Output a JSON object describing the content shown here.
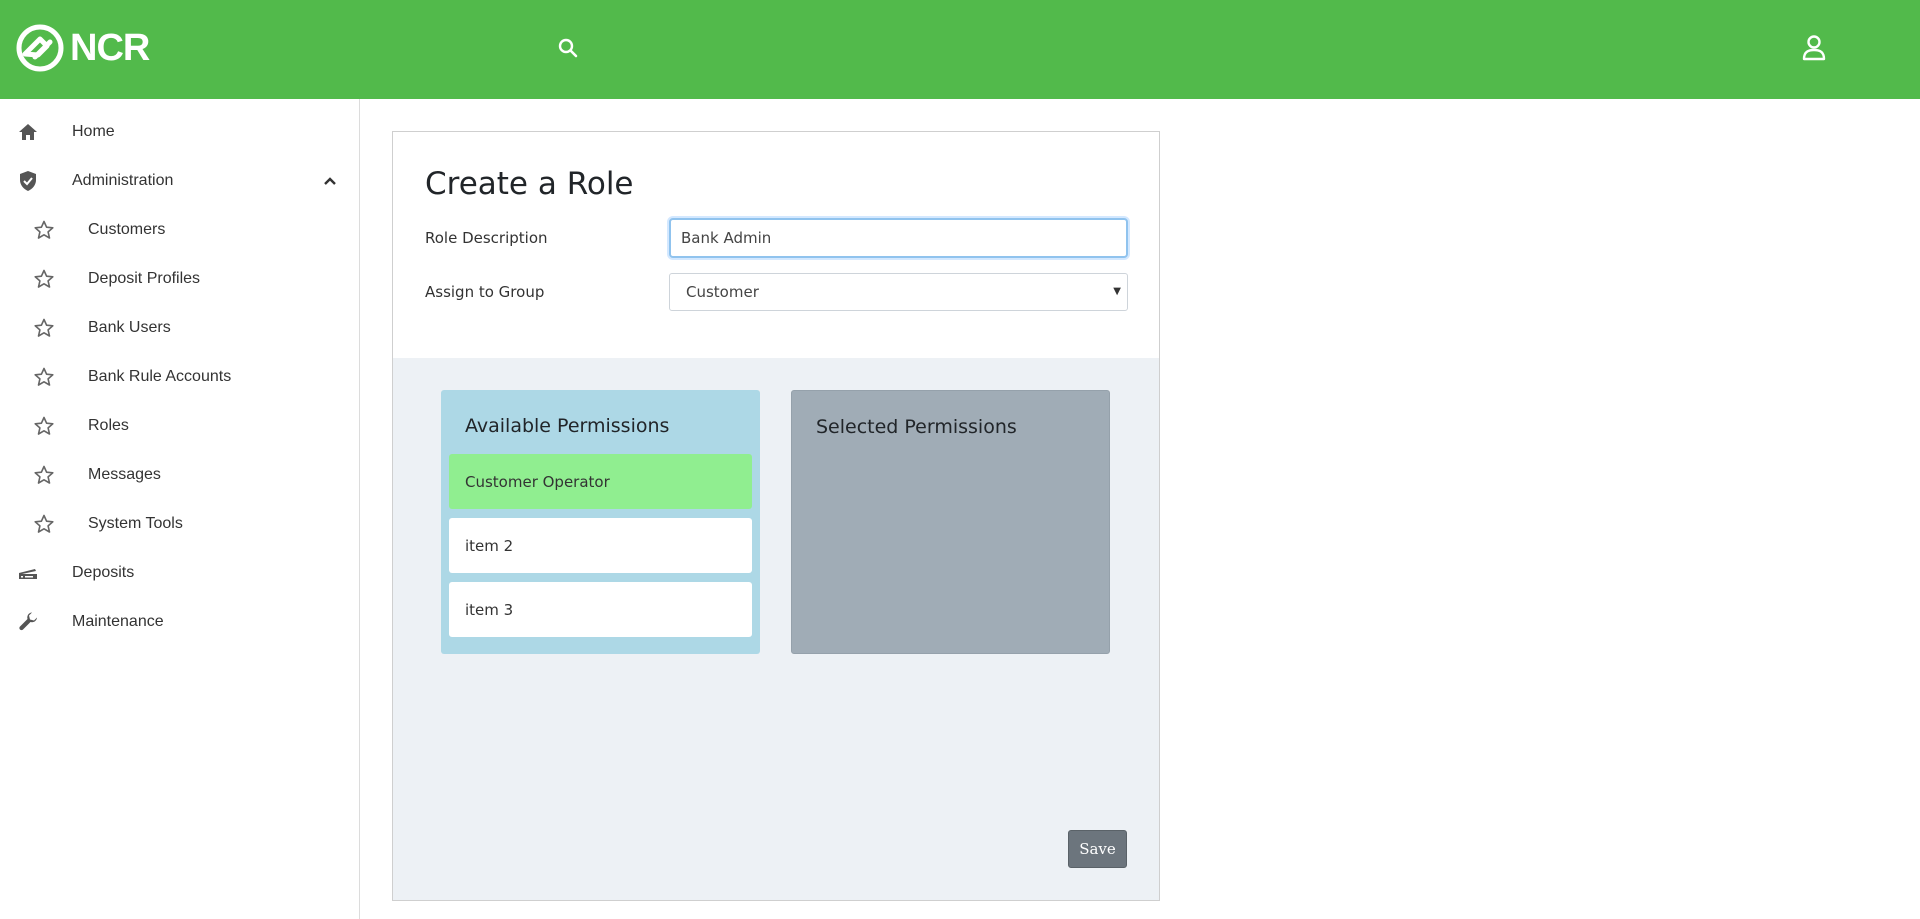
{
  "header": {
    "logo_text": "NCR",
    "search_icon": "search-icon",
    "user_icon": "user-icon",
    "brand_color": "#52ba4b"
  },
  "sidebar": {
    "items": [
      {
        "label": "Home",
        "icon": "home-icon"
      },
      {
        "label": "Administration",
        "icon": "shield-check-icon",
        "expanded": true
      },
      {
        "label": "Customers",
        "icon": "star-outline-icon"
      },
      {
        "label": "Deposit Profiles",
        "icon": "star-outline-icon"
      },
      {
        "label": "Bank Users",
        "icon": "star-outline-icon"
      },
      {
        "label": "Bank Rule Accounts",
        "icon": "star-outline-icon"
      },
      {
        "label": "Roles",
        "icon": "star-outline-icon"
      },
      {
        "label": "Messages",
        "icon": "star-outline-icon"
      },
      {
        "label": "System Tools",
        "icon": "star-outline-icon"
      },
      {
        "label": "Deposits",
        "icon": "scanner-icon"
      },
      {
        "label": "Maintenance",
        "icon": "wrench-icon"
      }
    ]
  },
  "form": {
    "title": "Create a Role",
    "role_description_label": "Role Description",
    "role_description_value": "Bank Admin",
    "assign_group_label": "Assign to Group",
    "assign_group_value": "Customer"
  },
  "permissions": {
    "available_title": "Available Permissions",
    "selected_title": "Selected Permissions",
    "available_items": [
      "Customer Operator",
      "item 2",
      "item 3"
    ],
    "selected_items": [],
    "highlight_color": "#90ee90",
    "available_bg": "#add8e6",
    "selected_bg": "#a0acb6"
  },
  "actions": {
    "save_label": "Save"
  }
}
